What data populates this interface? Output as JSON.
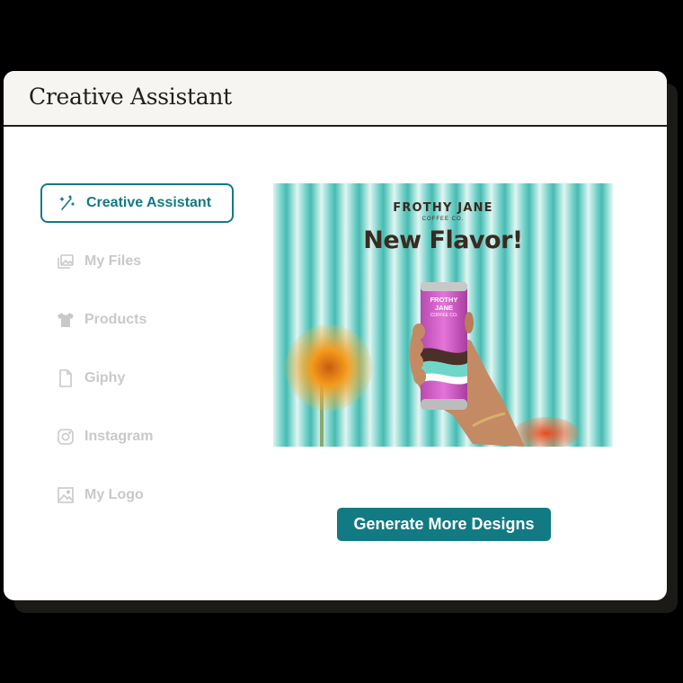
{
  "window": {
    "title": "Creative Assistant"
  },
  "sidebar": {
    "items": [
      {
        "label": "Creative Assistant",
        "icon": "magic-wand-icon",
        "active": true
      },
      {
        "label": "My Files",
        "icon": "images-icon",
        "active": false
      },
      {
        "label": "Products",
        "icon": "tshirt-icon",
        "active": false
      },
      {
        "label": "Giphy",
        "icon": "file-icon",
        "active": false
      },
      {
        "label": "Instagram",
        "icon": "instagram-icon",
        "active": false
      },
      {
        "label": "My Logo",
        "icon": "image-icon",
        "active": false
      }
    ]
  },
  "preview": {
    "brand": "FROTHY JANE",
    "brand_sub": "COFFEE CO.",
    "headline": "New Flavor!",
    "can_brand": "FROTHY JANE",
    "can_sub": "COFFEE CO."
  },
  "actions": {
    "generate_label": "Generate More Designs"
  },
  "colors": {
    "accent": "#127a82",
    "inactive": "#c9c9c9",
    "titlebar": "#f6f5f1"
  }
}
